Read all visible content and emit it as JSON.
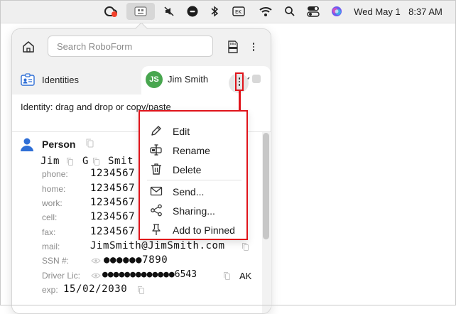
{
  "menubar": {
    "date": "Wed May 1",
    "time": "8:37 AM",
    "icons": [
      "creative-cloud-icon",
      "roboform-icon",
      "mute-icon",
      "stop-icon",
      "bluetooth-icon",
      "keyboard-input-icon",
      "wifi-icon",
      "spotlight-search-icon",
      "control-center-icon",
      "siri-icon"
    ]
  },
  "panel": {
    "search_placeholder": "Search RoboForm",
    "tab_identities": "Identities",
    "person_tab": {
      "initials": "JS",
      "name": "Jim Smith"
    },
    "toolbar_text": "Identity: drag and drop or copy/paste"
  },
  "identity": {
    "section": "Person",
    "name_parts": [
      "Jim",
      "G",
      "Smit"
    ],
    "fields": [
      {
        "label": "phone:",
        "value": "1234567"
      },
      {
        "label": "home:",
        "value": "1234567"
      },
      {
        "label": "work:",
        "value": "1234567"
      },
      {
        "label": "cell:",
        "value": "1234567"
      },
      {
        "label": "fax:",
        "value": "1234567"
      },
      {
        "label": "mail:",
        "value": "JimSmith@JimSmith.com"
      },
      {
        "label": "SSN #:",
        "value": "●●●●●●7890"
      },
      {
        "label": "Driver Lic:",
        "value": "●●●●●●●●●●●●●6543",
        "extra": "AK"
      },
      {
        "label": "exp:",
        "value": "15/02/2030"
      }
    ]
  },
  "context_menu": {
    "items": [
      {
        "label": "Edit",
        "icon": "pencil-icon"
      },
      {
        "label": "Rename",
        "icon": "rename-icon"
      },
      {
        "label": "Delete",
        "icon": "trash-icon"
      },
      {
        "label": "Send...",
        "icon": "envelope-icon"
      },
      {
        "label": "Sharing...",
        "icon": "share-icon"
      },
      {
        "label": "Add to Pinned",
        "icon": "pin-icon"
      }
    ]
  },
  "colors": {
    "highlight_red": "#e0141b",
    "avatar_green": "#48a64f",
    "person_icon_blue": "#2f6fd6",
    "label_gray": "#8a8a8a"
  }
}
